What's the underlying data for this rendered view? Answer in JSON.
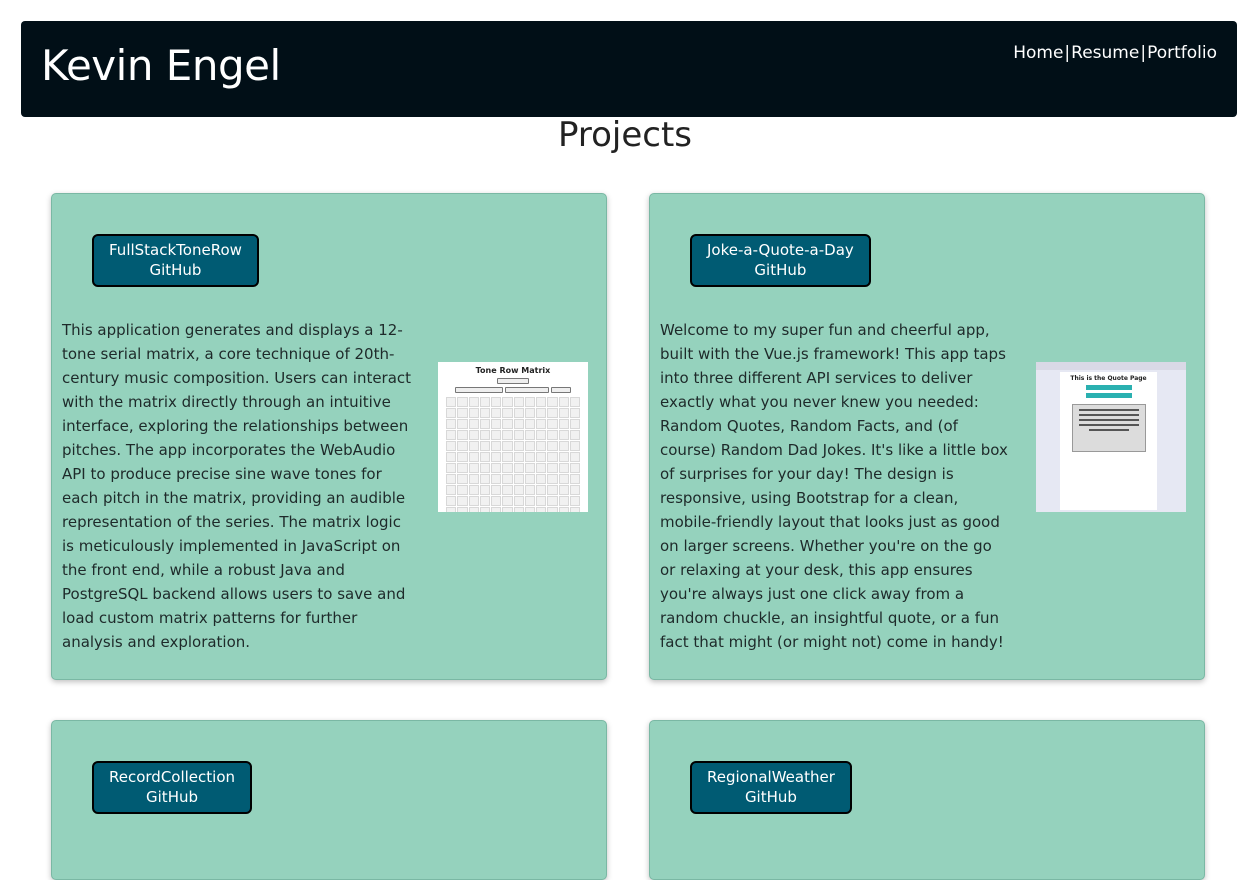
{
  "header": {
    "site_title": "Kevin Engel",
    "nav": [
      {
        "label": "Home"
      },
      {
        "label": "Resume"
      },
      {
        "label": "Portfolio"
      }
    ],
    "separator": "|"
  },
  "page_heading": "Projects",
  "projects": [
    {
      "name": "FullStackToneRow",
      "link_label": "GitHub",
      "description": "This application generates and displays a 12-tone serial matrix, a core technique of 20th-century music composition. Users can interact with the matrix directly through an intuitive interface, exploring the relationships between pitches. The app incorporates the WebAudio API to produce precise sine wave tones for each pitch in the matrix, providing an audible representation of the series. The matrix logic is meticulously implemented in JavaScript on the front end, while a robust Java and PostgreSQL backend allows users to save and load custom matrix patterns for further analysis and exploration.",
      "thumbnail": {
        "title": "Tone Row Matrix"
      }
    },
    {
      "name": "Joke-a-Quote-a-Day",
      "link_label": "GitHub",
      "description": "Welcome to my super fun and cheerful app, built with the Vue.js framework! This app taps into three different API services to deliver exactly what you never knew you needed: Random Quotes, Random Facts, and (of course) Random Dad Jokes. It's like a little box of surprises for your day! The design is responsive, using Bootstrap for a clean, mobile-friendly layout that looks just as good on larger screens. Whether you're on the go or relaxing at your desk, this app ensures you're always just one click away from a random chuckle, an insightful quote, or a fun fact that might (or might not) come in handy!",
      "thumbnail": {
        "title": "This is the Quote Page"
      }
    },
    {
      "name": "RecordCollection",
      "link_label": "GitHub"
    },
    {
      "name": "RegionalWeather",
      "link_label": "GitHub"
    }
  ],
  "colors": {
    "header_bg": "#010f17",
    "card_bg": "#95d2bd",
    "button_bg": "#005b73"
  }
}
